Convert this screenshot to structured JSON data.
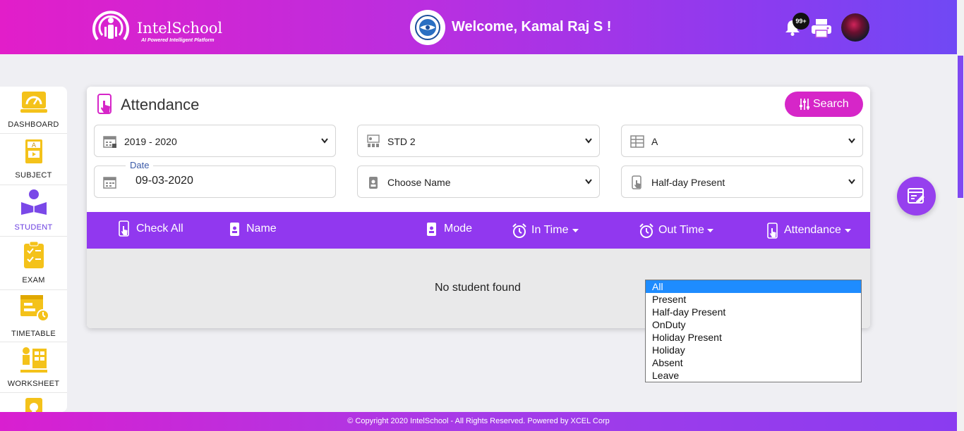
{
  "header": {
    "brand": "IntelSchool",
    "tagline": "AI Powered Intelligent Platform",
    "welcome": "Welcome, Kamal Raj S !",
    "notification_count": "99+"
  },
  "sidebar": {
    "items": [
      {
        "label": "DASHBOARD",
        "icon": "dashboard-icon"
      },
      {
        "label": "SUBJECT",
        "icon": "subject-icon"
      },
      {
        "label": "STUDENT",
        "icon": "student-icon",
        "active": true
      },
      {
        "label": "EXAM",
        "icon": "exam-icon"
      },
      {
        "label": "TIMETABLE",
        "icon": "timetable-icon"
      },
      {
        "label": "WORKSHEET",
        "icon": "worksheet-icon"
      }
    ]
  },
  "attendance": {
    "title": "Attendance",
    "search_label": "Search",
    "filters": {
      "year": "2019 - 2020",
      "standard": "STD 2",
      "section": "A",
      "date_label": "Date",
      "date": "09-03-2020",
      "name": "Choose Name",
      "status": "Half-day Present"
    },
    "columns": {
      "check_all": "Check All",
      "name": "Name",
      "mode": "Mode",
      "in_time": "In Time",
      "out_time": "Out Time",
      "attendance": "Attendance"
    },
    "empty_message": "No student found"
  },
  "attendance_dropdown": {
    "selected": "All",
    "options": [
      "All",
      "Present",
      "Half-day Present",
      "OnDuty",
      "Holiday Present",
      "Holiday",
      "Absent",
      "Leave"
    ]
  },
  "footer": {
    "text": "© Copyright 2020 IntelSchool - All Rights Reserved. Powered by XCEL Corp"
  },
  "colors": {
    "accent": "#9138ef",
    "pink": "#d626c8",
    "icon_yellow": "#f4c21a"
  }
}
